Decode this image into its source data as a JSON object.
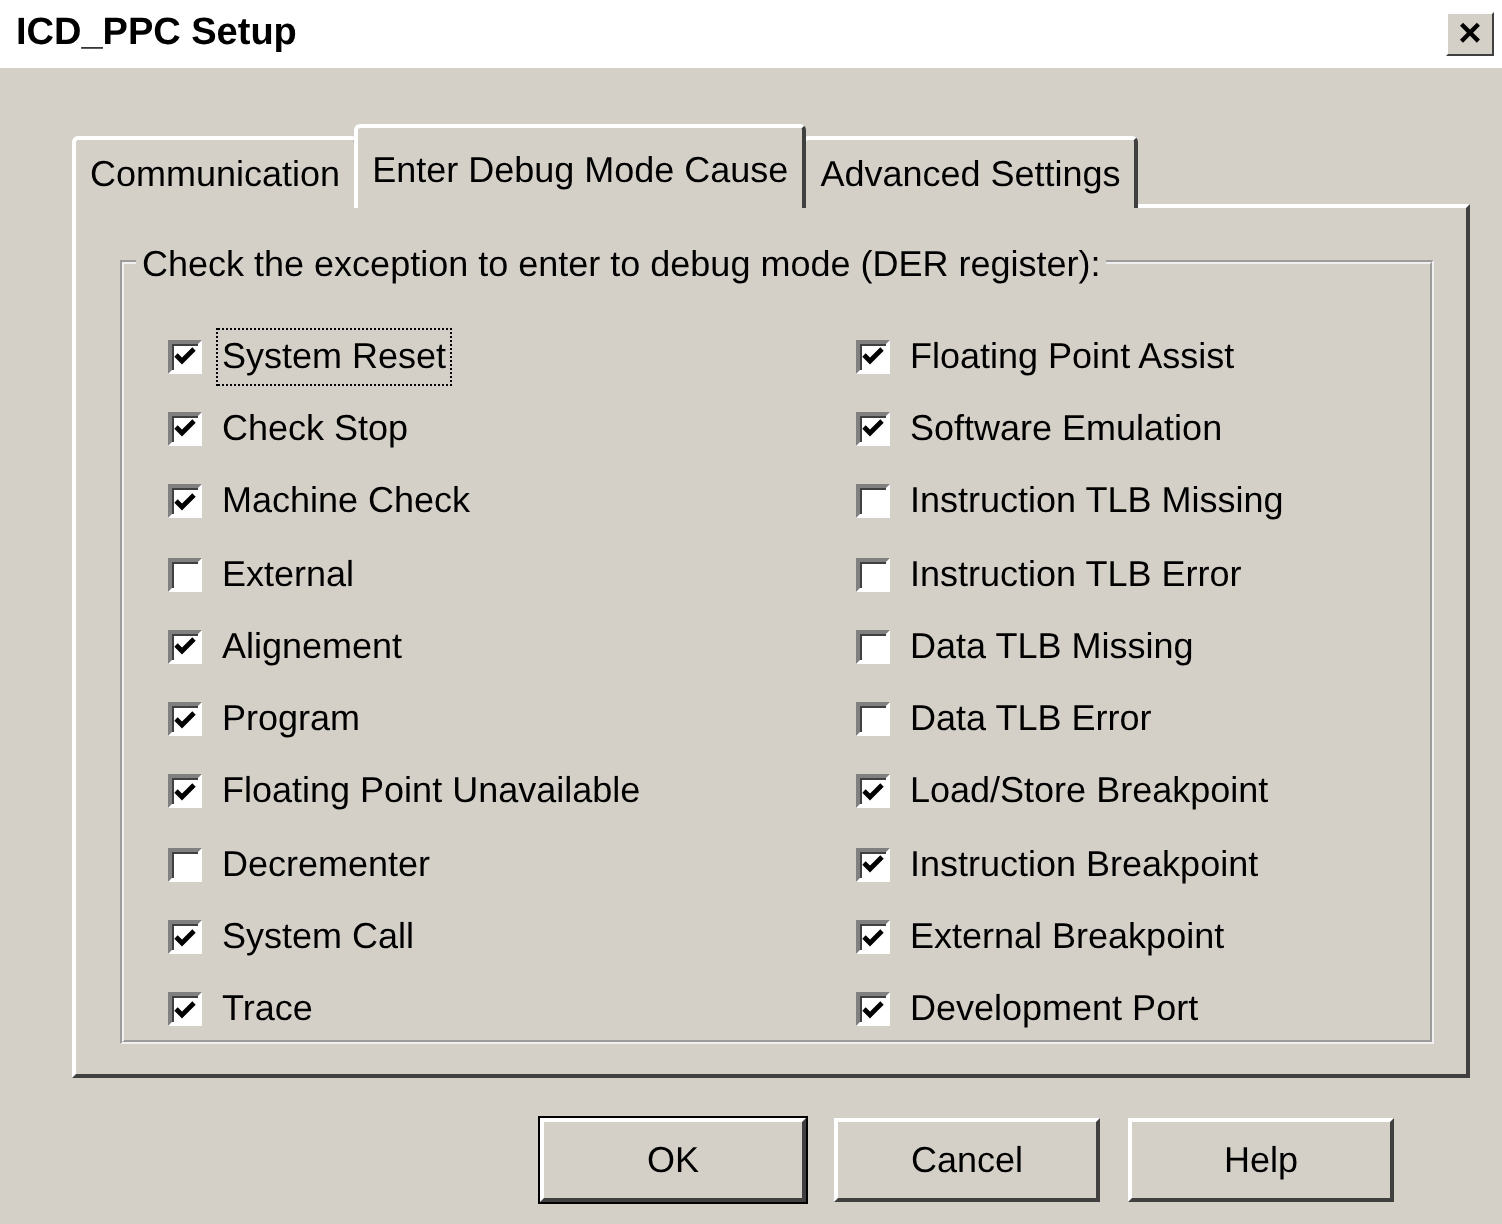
{
  "window": {
    "title": "ICD_PPC Setup",
    "close": "×"
  },
  "tabs": [
    {
      "label": "Communication",
      "selected": false
    },
    {
      "label": "Enter Debug Mode Cause",
      "selected": true
    },
    {
      "label": "Advanced Settings",
      "selected": false
    }
  ],
  "group": {
    "label": "Check the exception to enter to debug mode (DER register):"
  },
  "left": [
    {
      "label": "System Reset",
      "checked": true,
      "focused": true
    },
    {
      "label": "Check Stop",
      "checked": true,
      "focused": false
    },
    {
      "label": "Machine Check",
      "checked": true,
      "focused": false
    },
    {
      "label": "External",
      "checked": false,
      "focused": false
    },
    {
      "label": "Alignement",
      "checked": true,
      "focused": false
    },
    {
      "label": "Program",
      "checked": true,
      "focused": false
    },
    {
      "label": "Floating Point Unavailable",
      "checked": true,
      "focused": false
    },
    {
      "label": "Decrementer",
      "checked": false,
      "focused": false
    },
    {
      "label": "System Call",
      "checked": true,
      "focused": false
    },
    {
      "label": "Trace",
      "checked": true,
      "focused": false
    }
  ],
  "right": [
    {
      "label": "Floating Point Assist",
      "checked": true,
      "focused": false
    },
    {
      "label": "Software Emulation",
      "checked": true,
      "focused": false
    },
    {
      "label": "Instruction TLB Missing",
      "checked": false,
      "focused": false
    },
    {
      "label": "Instruction TLB Error",
      "checked": false,
      "focused": false
    },
    {
      "label": "Data TLB Missing",
      "checked": false,
      "focused": false
    },
    {
      "label": "Data TLB Error",
      "checked": false,
      "focused": false
    },
    {
      "label": "Load/Store Breakpoint",
      "checked": true,
      "focused": false
    },
    {
      "label": "Instruction Breakpoint",
      "checked": true,
      "focused": false
    },
    {
      "label": "External Breakpoint",
      "checked": true,
      "focused": false
    },
    {
      "label": "Development Port",
      "checked": true,
      "focused": false
    }
  ],
  "buttons": [
    "OK",
    "Cancel",
    "Help"
  ]
}
